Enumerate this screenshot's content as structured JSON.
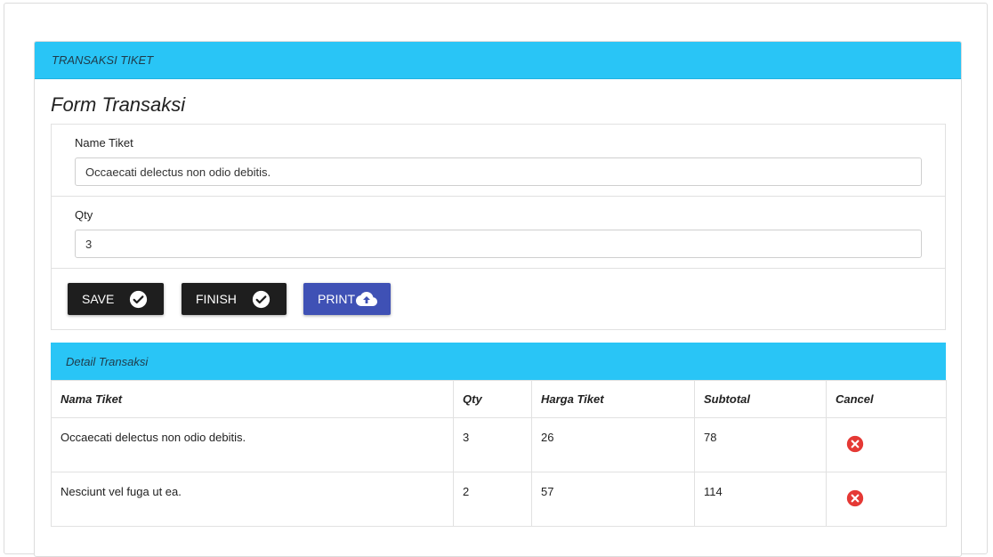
{
  "panel": {
    "title": "TRANSAKSI TIKET"
  },
  "form": {
    "title": "Form Transaksi",
    "name_label": "Name Tiket",
    "name_value": "Occaecati delectus non odio debitis.",
    "qty_label": "Qty",
    "qty_value": "3"
  },
  "buttons": {
    "save": "SAVE",
    "finish": "FINISH",
    "print": "PRINT"
  },
  "detail": {
    "title": "Detail Transaksi",
    "columns": [
      "Nama Tiket",
      "Qty",
      "Harga Tiket",
      "Subtotal",
      "Cancel"
    ],
    "rows": [
      {
        "name": "Occaecati delectus non odio debitis.",
        "qty": "3",
        "price": "26",
        "subtotal": "78"
      },
      {
        "name": "Nesciunt vel fuga ut ea.",
        "qty": "2",
        "price": "57",
        "subtotal": "114"
      }
    ]
  },
  "icons": {
    "check": "check-circle-icon",
    "upload": "cloud-upload-icon",
    "cancel": "cancel-circle-icon"
  },
  "colors": {
    "header": "#29c5f6",
    "dark_button": "#1e1e1e",
    "print_button": "#3f51b5",
    "cancel": "#e53935"
  }
}
